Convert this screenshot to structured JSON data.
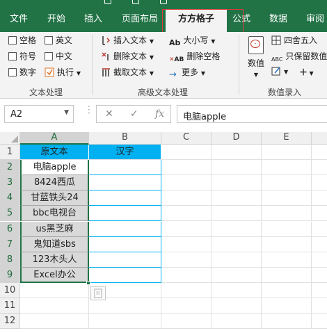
{
  "tabs": [
    {
      "label": "文件"
    },
    {
      "label": "开始"
    },
    {
      "label": "插入"
    },
    {
      "label": "页面布局"
    },
    {
      "label": "方方格子"
    },
    {
      "label": "公式"
    },
    {
      "label": "数据"
    },
    {
      "label": "审阅"
    }
  ],
  "ribbon": {
    "text_group": {
      "items": [
        "空格",
        "英文",
        "符号",
        "中文",
        "数字",
        "执行"
      ],
      "label": "文本处理"
    },
    "advanced_group": {
      "items": [
        "插入文本",
        "删除文本",
        "截取文本",
        "大小写",
        "删除空格",
        "更多"
      ],
      "label": "高级文本处理"
    },
    "number_group": {
      "value_label": "数值",
      "items": [
        "四舍五入",
        "只保留数值"
      ],
      "label": "数值录入"
    }
  },
  "formula_bar": {
    "name_box": "A2",
    "cancel": "✕",
    "enter": "✓",
    "fx": "fx",
    "value": "电脑apple"
  },
  "columns": [
    "A",
    "B",
    "C",
    "D",
    "E"
  ],
  "rows": [
    "1",
    "2",
    "3",
    "4",
    "5",
    "6",
    "7",
    "8",
    "9",
    "10",
    "11",
    "12"
  ],
  "table": {
    "headers": [
      "原文本",
      "汉字"
    ],
    "values": [
      "电脑apple",
      "8424西瓜",
      "甘蓝铁头24",
      "bbc电视台",
      "us黑芝麻",
      "鬼知道sbs",
      "123木头人",
      "Excel办公"
    ]
  },
  "colors": {
    "accent": "#217346",
    "header_fill": "#00b0f0",
    "selection_fill": "#d9d9d9"
  }
}
